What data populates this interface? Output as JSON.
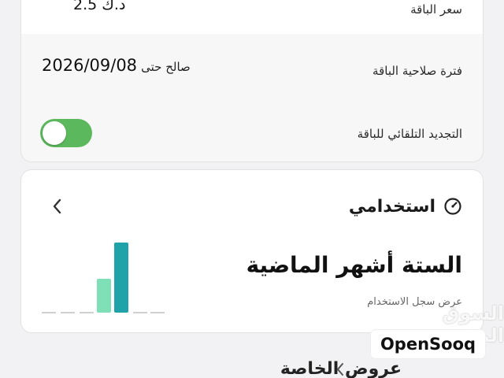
{
  "package": {
    "price_label": "سعر الباقة",
    "price_value": "2.5 د.ك",
    "validity_label": "فترة صلاحية الباقة",
    "validity_prefix": "صالح حتى",
    "validity_date": "2026/09/08",
    "auto_renew_label": "التجديد التلقائي للباقة",
    "auto_renew_on": true,
    "toggle_color": "#5cb85c"
  },
  "usage": {
    "title": "استخدامي",
    "title_icon": "gauge-icon",
    "period": "الستة أشهر الماضية",
    "history_link": "عرض سجل الاستخدام",
    "chevron_icon": "chevron-left-icon",
    "bar_colors": [
      "#7fe0b8",
      "#1fa3a8"
    ]
  },
  "offers": {
    "title": "عروض الخاصة"
  },
  "watermark": {
    "arabic": "السوق المفتوح",
    "brand": "OpenSooq"
  }
}
